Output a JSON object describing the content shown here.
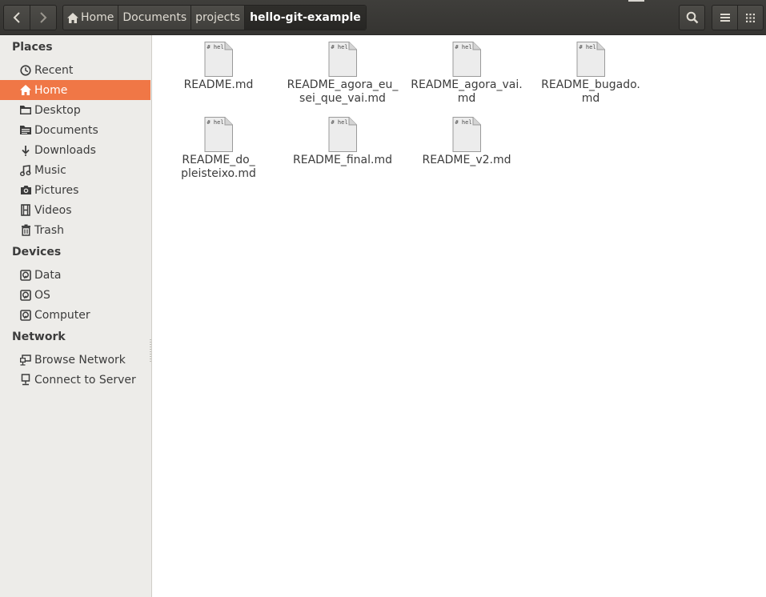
{
  "toolbar": {
    "breadcrumbs": [
      {
        "label": "Home",
        "icon": "home-icon"
      },
      {
        "label": "Documents"
      },
      {
        "label": "projects"
      },
      {
        "label": "hello-git-example",
        "active": true
      }
    ]
  },
  "sidebar": {
    "sections": {
      "places": "Places",
      "devices": "Devices",
      "network": "Network"
    },
    "places": [
      {
        "label": "Recent",
        "icon": "clock-icon"
      },
      {
        "label": "Home",
        "icon": "home-icon",
        "selected": true
      },
      {
        "label": "Desktop",
        "icon": "folder-icon"
      },
      {
        "label": "Documents",
        "icon": "document-icon"
      },
      {
        "label": "Downloads",
        "icon": "download-icon"
      },
      {
        "label": "Music",
        "icon": "music-icon"
      },
      {
        "label": "Pictures",
        "icon": "camera-icon"
      },
      {
        "label": "Videos",
        "icon": "film-icon"
      },
      {
        "label": "Trash",
        "icon": "trash-icon"
      }
    ],
    "devices": [
      {
        "label": "Data",
        "icon": "drive-icon"
      },
      {
        "label": "OS",
        "icon": "drive-icon"
      },
      {
        "label": "Computer",
        "icon": "drive-icon"
      }
    ],
    "network": [
      {
        "label": "Browse Network",
        "icon": "network-icon"
      },
      {
        "label": "Connect to Server",
        "icon": "server-icon"
      }
    ]
  },
  "files": [
    {
      "name": "README.md",
      "preview": "# hel"
    },
    {
      "name": "README_agora_eu_\nsei_que_vai.md",
      "preview": "# hel"
    },
    {
      "name": "README_agora_vai.\nmd",
      "preview": "# hel"
    },
    {
      "name": "README_bugado.\nmd",
      "preview": "# hel"
    },
    {
      "name": "README_do_\npleisteixo.md",
      "preview": "# hel"
    },
    {
      "name": "README_final.md",
      "preview": "# hel"
    },
    {
      "name": "README_v2.md",
      "preview": "# hel"
    }
  ],
  "colors": {
    "selection": "#f07746",
    "toolbar": "#3c3b37",
    "sidebar": "#edece9"
  }
}
